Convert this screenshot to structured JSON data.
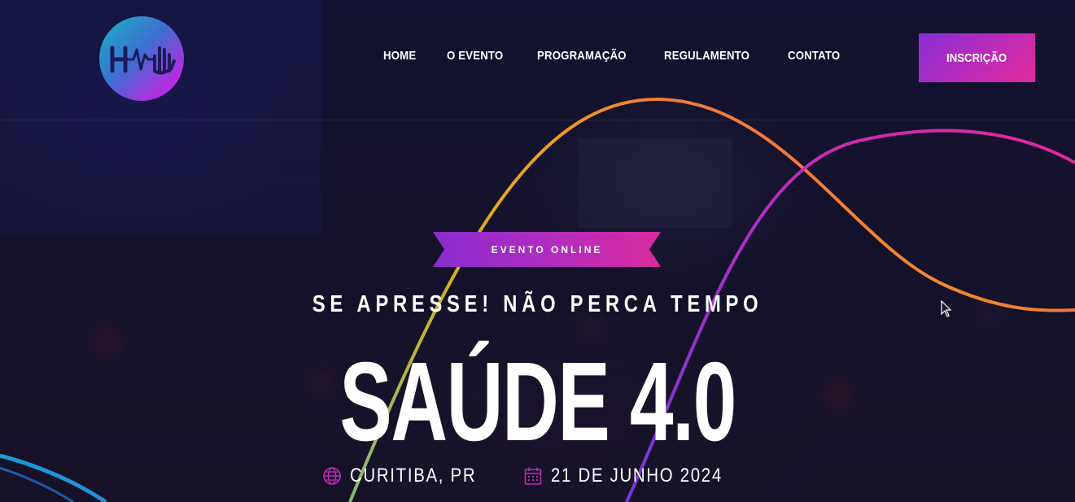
{
  "nav": {
    "items": [
      "HOME",
      "O EVENTO",
      "PROGRAMAÇÃO",
      "REGULAMENTO",
      "CONTATO"
    ],
    "cta_label": "INSCRIÇÃO"
  },
  "hero": {
    "badge": "EVENTO ONLINE",
    "subtitle": "SE APRESSE! NÃO PERCA TEMPO",
    "title": "SAÚDE 4.0",
    "location": "CURITIBA, PR",
    "date": "21 DE JUNHO 2024"
  },
  "icons": {
    "logo": "heartbeat-hand-logo",
    "location": "globe-icon",
    "date": "calendar-icon",
    "cursor": "mouse-cursor-icon"
  },
  "colors": {
    "background": "#12112b",
    "accent_purple": "#8a2cd6",
    "accent_pink": "#e02a9a",
    "line_orange": "#f2a01c",
    "line_teal": "#19b4c4"
  }
}
